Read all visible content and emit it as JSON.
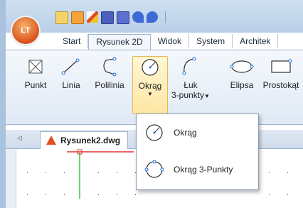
{
  "qat": {
    "icons": [
      "new-icon",
      "open-icon",
      "draw-icon",
      "save-icon",
      "save-as-icon",
      "undo-icon",
      "redo-icon"
    ]
  },
  "tabs": [
    "Start",
    "Rysunek 2D",
    "Widok",
    "System",
    "Architek"
  ],
  "active_tab": "Rysunek 2D",
  "ribbon": {
    "punkt": "Punkt",
    "linia": "Linia",
    "polilinia": "Polilinia",
    "okrag": "Okrąg",
    "luk_line1": "Łuk",
    "luk_line2": "3-punkty",
    "elipsa": "Elipsa",
    "prostokat": "Prostokąt"
  },
  "file_tab": "Rysunek2.dwg",
  "dropdown": {
    "items": [
      {
        "label": "Okrąg"
      },
      {
        "label": "Okrąg 3-Punkty"
      }
    ]
  },
  "colors": {
    "accent": "#d9531b",
    "highlight": "#fde6a4"
  }
}
